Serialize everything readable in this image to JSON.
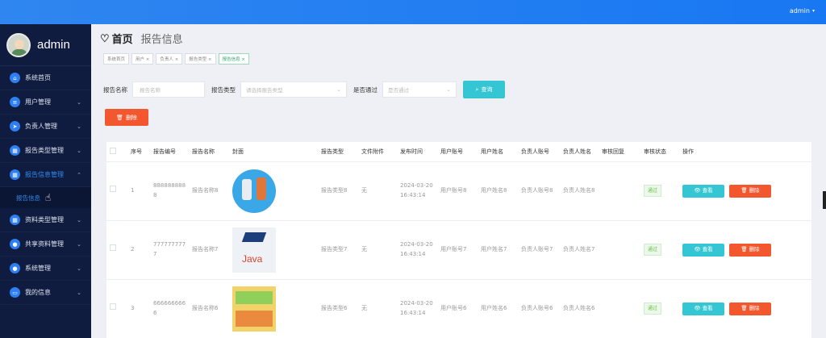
{
  "topbar": {
    "user": "admin"
  },
  "sidebar": {
    "brand": "admin",
    "items": [
      {
        "label": "系统首页",
        "icon": "home-icon",
        "arrow": false
      },
      {
        "label": "用户管理",
        "icon": "list-icon",
        "arrow": true
      },
      {
        "label": "负责人管理",
        "icon": "send-icon",
        "arrow": true
      },
      {
        "label": "报告类型管理",
        "icon": "grid-icon",
        "arrow": true
      },
      {
        "label": "报告信息管理",
        "icon": "grid-icon",
        "arrow": true,
        "active": true
      },
      {
        "label": "资料类型管理",
        "icon": "grid-icon",
        "arrow": true
      },
      {
        "label": "共享资料管理",
        "icon": "user-icon",
        "arrow": true
      },
      {
        "label": "系统管理",
        "icon": "user-icon",
        "arrow": true
      },
      {
        "label": "我的信息",
        "icon": "card-icon",
        "arrow": true
      }
    ],
    "subitem": "报告信息"
  },
  "breadcrumb": {
    "home": "首页",
    "current": "报告信息"
  },
  "tags": [
    "系统首页",
    "用户 ×",
    "负责人 ×",
    "报告类型 ×",
    "报告信息 ×"
  ],
  "search": {
    "name_label": "报告名称",
    "name_placeholder": "报告名称",
    "type_label": "报告类型",
    "type_placeholder": "请选择报告类型",
    "pass_label": "是否通过",
    "pass_placeholder": "是否通过",
    "search_button": "查询"
  },
  "actions": {
    "delete_button": "删除"
  },
  "table": {
    "columns": [
      "",
      "序号",
      "报告编号",
      "报告名称",
      "封面",
      "报告类型",
      "文件附件",
      "发布时间",
      "用户账号",
      "用户姓名",
      "负责人账号",
      "负责人姓名",
      "审核回复",
      "审核状态",
      "操作"
    ],
    "view_label": "查看",
    "delete_label": "删除",
    "rows": [
      {
        "index": "1",
        "code": "8888888888",
        "name": "报告名称8",
        "cover": "robots",
        "type": "报告类型8",
        "file": "无",
        "time": "2024-03-20 16:43:14",
        "account": "用户账号8",
        "username": "用户姓名8",
        "owner_account": "负责人账号8",
        "owner_name": "负责人姓名8",
        "reply": "",
        "status": "通过"
      },
      {
        "index": "2",
        "code": "7777777777",
        "name": "报告名称7",
        "cover": "java",
        "type": "报告类型7",
        "file": "无",
        "time": "2024-03-20 16:43:14",
        "account": "用户账号7",
        "username": "用户姓名7",
        "owner_account": "负责人账号7",
        "owner_name": "负责人姓名7",
        "reply": "",
        "status": "通过"
      },
      {
        "index": "3",
        "code": "6666666666",
        "name": "报告名称6",
        "cover": "kids",
        "type": "报告类型6",
        "file": "无",
        "time": "2024-03-20 16:43:14",
        "account": "用户账号6",
        "username": "用户姓名6",
        "owner_account": "负责人账号6",
        "owner_name": "负责人姓名6",
        "reply": "",
        "status": "通过"
      }
    ]
  },
  "colors": {
    "primary": "#2d8cf0",
    "cyan": "#34c6d3",
    "danger": "#f2572d",
    "sidebar": "#0f1b3f"
  }
}
